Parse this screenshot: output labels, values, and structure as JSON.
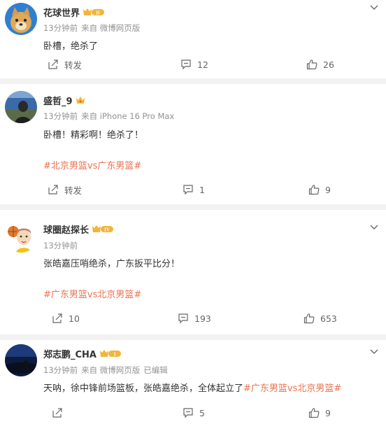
{
  "comments": [
    {
      "username": "花球世界",
      "badge": "II",
      "time": "13分钟前",
      "source": "来自 微博网页版",
      "edited": "",
      "text": "卧槽，绝杀了",
      "tag": "",
      "repost_label": "转发",
      "comment_count": "12",
      "like_count": "26"
    },
    {
      "username": "盛哲_9",
      "badge": "",
      "time": "13分钟前",
      "source": "来自 iPhone 16 Pro Max",
      "edited": "",
      "text": "卧槽！精彩啊！绝杀了！",
      "tag": "#北京男篮vs广东男篮#",
      "repost_label": "转发",
      "comment_count": "1",
      "like_count": "9"
    },
    {
      "username": "球圈赵探长",
      "badge": "IV",
      "time": "13分钟前",
      "source": "",
      "edited": "",
      "text": "张皓嘉压哨绝杀，广东扳平比分！",
      "tag": "#广东男篮vs北京男篮#",
      "repost_label": "10",
      "comment_count": "193",
      "like_count": "653"
    },
    {
      "username": "郑志鹏_CHA",
      "badge": "I",
      "time": "13分钟前",
      "source": "来自 微博网页版",
      "edited": "已编辑",
      "text": "天呐，徐中锋前场篮板，张皓嘉绝杀，全体起立了",
      "tag": "#广东男篮vs北京男篮#",
      "repost_label": "",
      "comment_count": "5",
      "like_count": "9"
    }
  ],
  "colors": {
    "tag": "#eb7350",
    "badge_gold": "#f3b43a",
    "meta": "#939393",
    "background": "#f2f2f2"
  }
}
